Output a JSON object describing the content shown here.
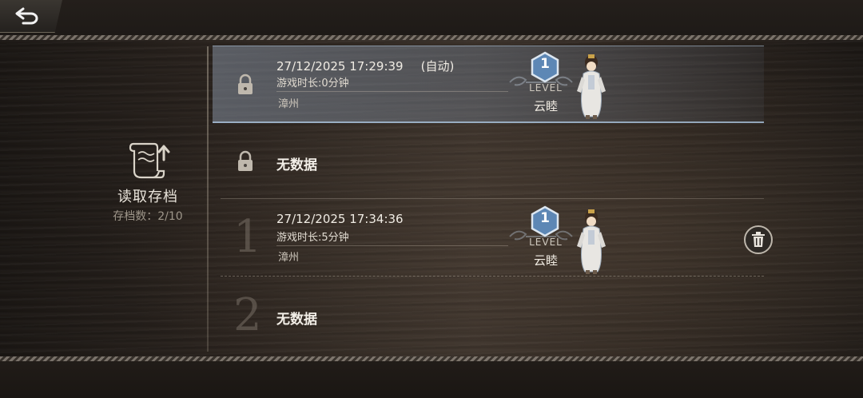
{
  "header": {
    "back_icon": "back-arrow-icon"
  },
  "sidebar": {
    "icon": "scroll-upload-icon",
    "title": "读取存档",
    "count_text": "存档数：2/10"
  },
  "slots": [
    {
      "kind": "auto",
      "lock_icon": "padlock-icon",
      "date": "27/12/2025 17:29:39",
      "auto_label": "(自动)",
      "playtime": "游戏时长:0分钟",
      "place": "漳州",
      "level": "1",
      "level_label": "LEVEL",
      "character": "云睦",
      "selected": true
    },
    {
      "kind": "auto-empty",
      "lock_icon": "padlock-icon",
      "empty_text": "无数据"
    },
    {
      "kind": "manual",
      "number": "1",
      "date": "27/12/2025 17:34:36",
      "playtime": "游戏时长:5分钟",
      "place": "漳州",
      "level": "1",
      "level_label": "LEVEL",
      "character": "云睦",
      "delete_icon": "trash-icon"
    },
    {
      "kind": "manual-empty",
      "number": "2",
      "empty_text": "无数据"
    }
  ],
  "colors": {
    "selected_highlight": "#96a5b9",
    "level_hex": "#5d87b5",
    "wood_dark": "#1c1815",
    "wood_light": "#3a312a"
  }
}
